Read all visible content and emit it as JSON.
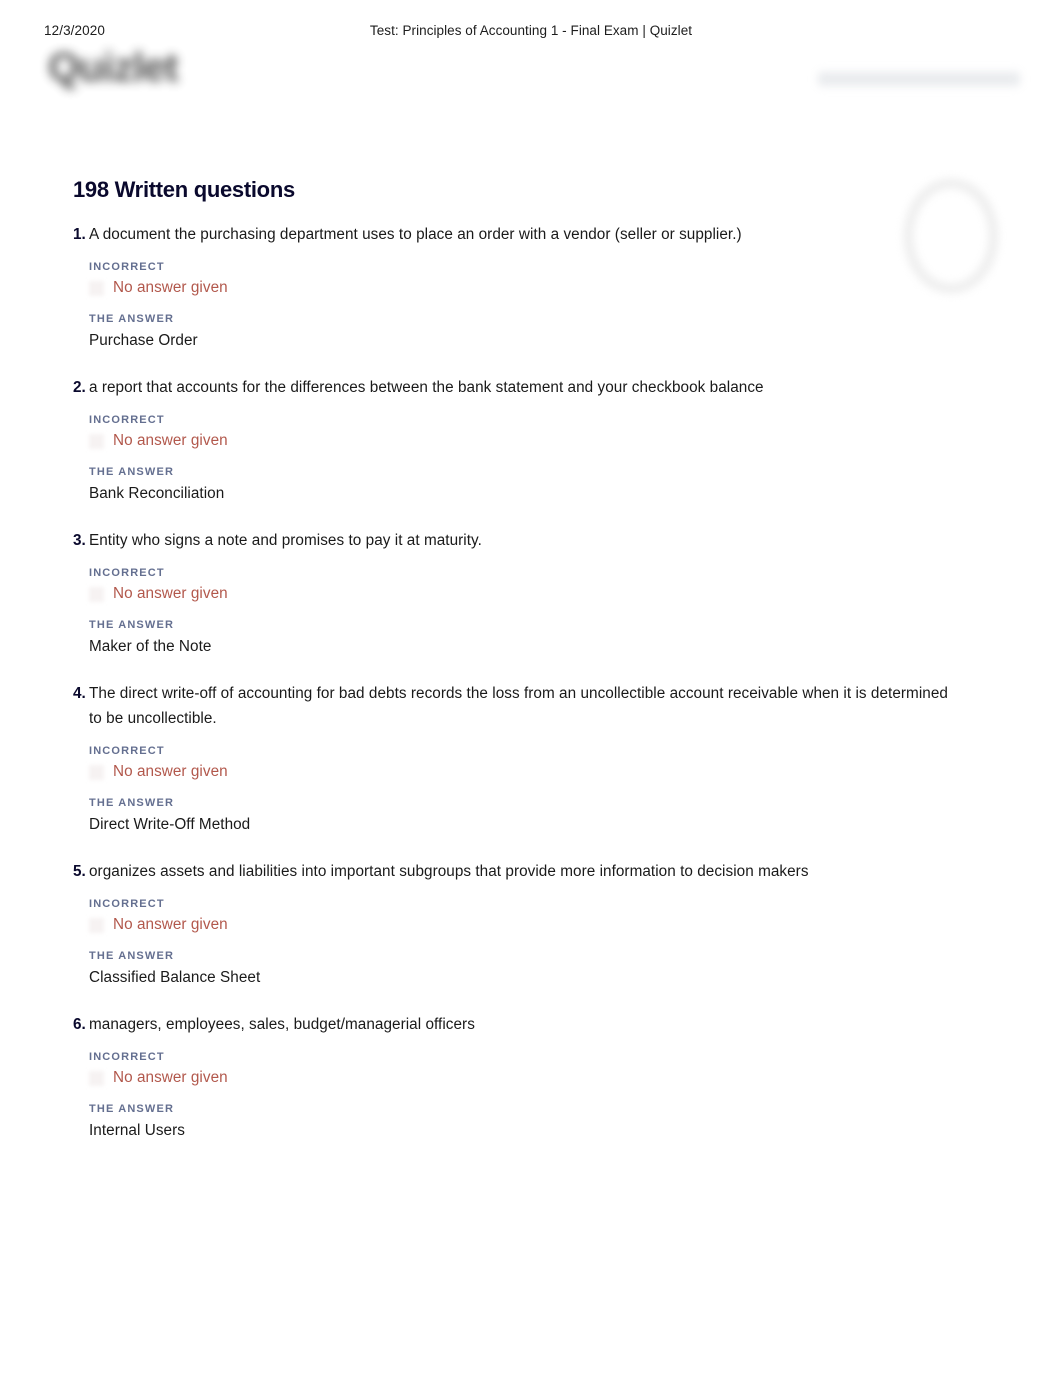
{
  "print_header": {
    "date": "12/3/2020",
    "document_title": "Test: Principles of Accounting 1 - Final Exam | Quizlet"
  },
  "brand": {
    "logo_text": "Quizlet",
    "logo_icon": "quizlet-wordmark-logo"
  },
  "main": {
    "heading": "198 Written questions",
    "labels": {
      "incorrect": "INCORRECT",
      "the_answer": "THE ANSWER"
    },
    "no_answer_text": "No answer given",
    "marker_icon": "incorrect-x-icon",
    "questions": [
      {
        "number": "1.",
        "prompt": "A document the purchasing department uses to place an order with a vendor (seller or supplier.)",
        "status": "INCORRECT",
        "user_answer": "No answer given",
        "correct_answer": "Purchase Order"
      },
      {
        "number": "2.",
        "prompt": "a report that accounts for the differences between the bank statement and your checkbook balance",
        "status": "INCORRECT",
        "user_answer": "No answer given",
        "correct_answer": "Bank Reconciliation"
      },
      {
        "number": "3.",
        "prompt": "Entity who signs a note and promises to pay it at maturity.",
        "status": "INCORRECT",
        "user_answer": "No answer given",
        "correct_answer": "Maker of the Note"
      },
      {
        "number": "4.",
        "prompt": "The direct write-off of accounting for bad debts records the loss from an uncollectible account receivable when it is determined to be uncollectible.",
        "status": "INCORRECT",
        "user_answer": "No answer given",
        "correct_answer": "Direct Write-Off Method"
      },
      {
        "number": "5.",
        "prompt": "organizes assets and liabilities into important subgroups that provide more information to decision makers",
        "status": "INCORRECT",
        "user_answer": "No answer given",
        "correct_answer": "Classified Balance Sheet"
      },
      {
        "number": "6.",
        "prompt": "managers, employees, sales, budget/managerial officers",
        "status": "INCORRECT",
        "user_answer": "No answer given",
        "correct_answer": "Internal Users"
      }
    ]
  },
  "colors": {
    "incorrect_red": "#b2584c",
    "meta_gray": "#646f90",
    "text_black": "#1a1a1a",
    "heading_navy": "#0a092d"
  }
}
